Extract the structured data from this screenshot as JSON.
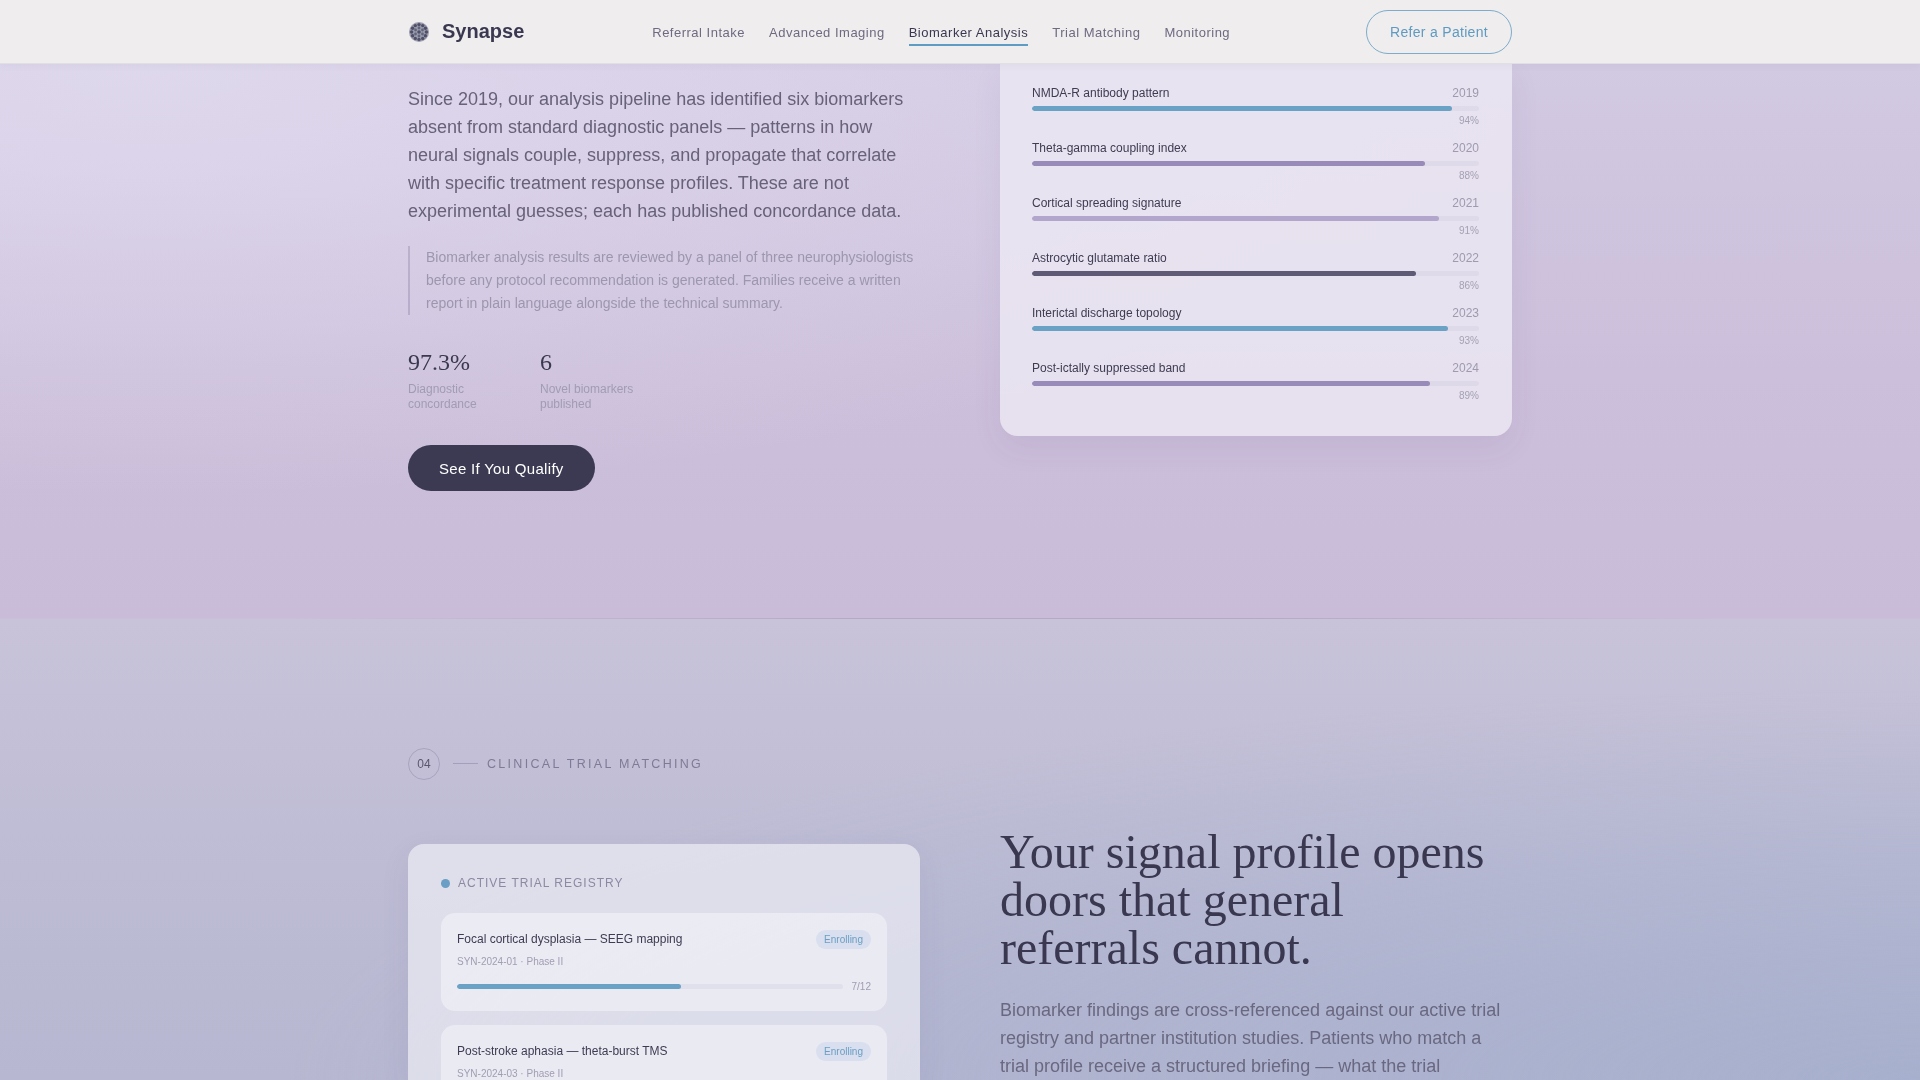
{
  "nav": {
    "brand": "Synapse",
    "links": [
      {
        "label": "Referral Intake",
        "selected": false
      },
      {
        "label": "Advanced Imaging",
        "selected": false
      },
      {
        "label": "Biomarker Analysis",
        "selected": true
      },
      {
        "label": "Trial Matching",
        "selected": false
      },
      {
        "label": "Monitoring",
        "selected": false
      }
    ],
    "cta": "Refer a Patient"
  },
  "biomarkers": {
    "intro": "Since 2019, our analysis pipeline has identified six biomarkers absent from standard diagnostic panels — patterns in how neural signals couple, suppress, and propagate that correlate with specific treatment response profiles. These are not experimental guesses; each has published concordance data.",
    "note": "Biomarker analysis results are reviewed by a panel of three neurophysiologists before any protocol recommendation is generated. Families receive a written report in plain language alongside the technical summary.",
    "stats": [
      {
        "value": "97.3%",
        "label": "Diagnostic concordance"
      },
      {
        "value": "6",
        "label": "Novel biomarkers published"
      }
    ],
    "cta": "See If You Qualify",
    "markers": [
      {
        "name": "NMDA-R antibody pattern",
        "year": "2019",
        "level": 0.94,
        "reading": "94%",
        "color": "#6aa2c6"
      },
      {
        "name": "Theta-gamma coupling index",
        "year": "2020",
        "level": 0.88,
        "reading": "88%",
        "color": "#988bb9"
      },
      {
        "name": "Cortical spreading signature",
        "year": "2021",
        "level": 0.91,
        "reading": "91%",
        "color": "#b2a6cc"
      },
      {
        "name": "Astrocytic glutamate ratio",
        "year": "2022",
        "level": 0.86,
        "reading": "86%",
        "color": "#5f5b76"
      },
      {
        "name": "Interictal discharge topology",
        "year": "2023",
        "level": 0.93,
        "reading": "93%",
        "color": "#6aa2c6"
      },
      {
        "name": "Post-ictally suppressed band",
        "year": "2024",
        "level": 0.89,
        "reading": "89%",
        "color": "#988bb9"
      }
    ]
  },
  "trial_matching": {
    "number": "04",
    "eyebrow": "CLINICAL TRIAL MATCHING",
    "registry": {
      "title": "ACTIVE TRIAL REGISTRY",
      "trials": [
        {
          "title": "Focal cortical dysplasia — SEEG mapping",
          "meta": "SYN-2024-01 · Phase II",
          "status": "Enrolling",
          "level": 0.58,
          "count": "7/12"
        },
        {
          "title": "Post-stroke aphasia — theta-burst TMS",
          "meta": "SYN-2024-03 · Phase II",
          "status": "Enrolling"
        }
      ]
    },
    "heading": "Your signal profile opens doors that general referrals cannot.",
    "body": "Biomarker findings are cross-referenced against our active trial registry and partner institution studies. Patients who match a trial profile receive a structured briefing — what the trial"
  }
}
